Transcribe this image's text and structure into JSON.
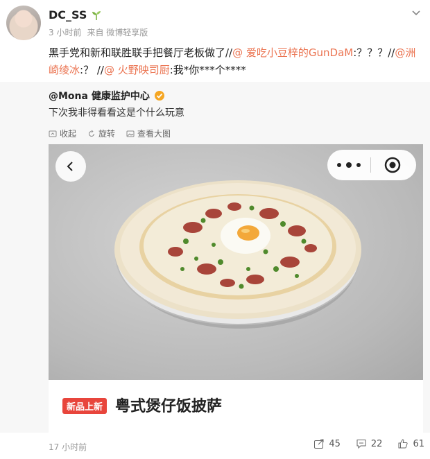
{
  "post": {
    "username": "DC_SS",
    "time": "3 小时前",
    "source": "来自 微博轻享版",
    "text_prefix": "黑手党和新和联胜联手把餐厅老板做了//",
    "mention1": "@ 爱吃小豆梓的GunDaM",
    "text_mid1": ":？？？//",
    "mention2": "@洲崎绫冰",
    "text_mid2": ":？ //",
    "mention3": "@ 火野映司厨",
    "text_suffix": ":我*你***个****"
  },
  "repost": {
    "author": "@Mona 健康监护中心",
    "text": "下次我非得看看这是个什么玩意",
    "actions": {
      "collect": "收起",
      "rotate": "旋转",
      "view_large": "查看大图"
    },
    "banner": {
      "new_tag": "新品上新",
      "dish_name": "粤式煲仔饭披萨"
    }
  },
  "footer": {
    "time": "17 小时前",
    "reposts": "45",
    "comments": "22",
    "likes": "61"
  },
  "colors": {
    "mention": "#eb7350",
    "new_tag": "#e8453c"
  }
}
